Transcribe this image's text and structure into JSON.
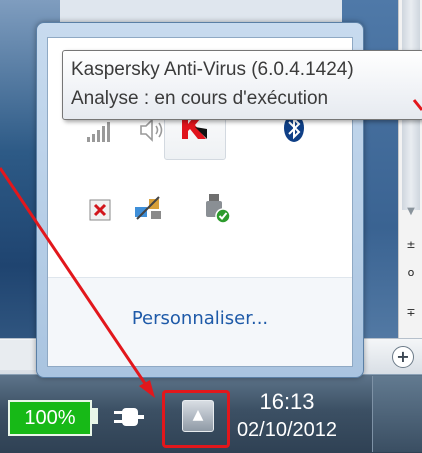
{
  "tooltip": {
    "title": "Kaspersky Anti-Virus (6.0.4.1424)",
    "status": "Analyse : en cours d'exécution"
  },
  "flyout": {
    "customize_label": "Personnaliser...",
    "icons": [
      "network-icon",
      "volume-icon",
      "kaspersky-icon",
      "bluetooth-icon",
      "action-center-icon",
      "network-share-icon",
      "usb-safe-remove-icon"
    ]
  },
  "taskbar": {
    "battery_label": "100%",
    "show_hidden_symbol": "▲",
    "time": "16:13",
    "date": "02/10/2012"
  },
  "scrollbar": {
    "up_symbol": "±",
    "mid_symbol": "o",
    "down_symbol": "∓",
    "plus_symbol": "+"
  },
  "colors": {
    "highlight": "#e2171c",
    "battery": "#17b917",
    "link": "#1e5aa8"
  }
}
